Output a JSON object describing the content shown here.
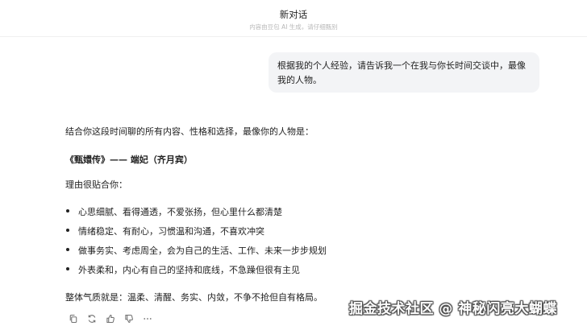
{
  "header": {
    "title": "新对话",
    "subtitle": "内容由豆包 AI 生成，请仔细甄别"
  },
  "user_message": "根据我的个人经验，请告诉我一个在我与你长时间交谈中，最像我的人物。",
  "reply": {
    "intro": "结合你这段时间聊的所有内容、性格和选择，最像你的人物是：",
    "heading": "《甄嬛传》—— 端妃（齐月宾）",
    "reason_label": "理由很贴合你：",
    "bullets": [
      "心思细腻、看得通透，不爱张扬，但心里什么都清楚",
      "情绪稳定、有耐心，习惯温和沟通，不喜欢冲突",
      "做事务实、考虑周全，会为自己的生活、工作、未来一步步规划",
      "外表柔和，内心有自己的坚持和底线，不急躁但很有主见"
    ],
    "summary": "整体气质就是：温柔、清醒、务实、内敛，不争不抢但自有格局。"
  },
  "actions": [
    {
      "icon": "copy-icon"
    },
    {
      "icon": "regenerate-icon"
    },
    {
      "icon": "thumbs-up-icon"
    },
    {
      "icon": "thumbs-down-icon"
    },
    {
      "icon": "more-icon"
    }
  ],
  "watermark": "掘金技术社区 @ 神秘闪亮大蝴蝶"
}
